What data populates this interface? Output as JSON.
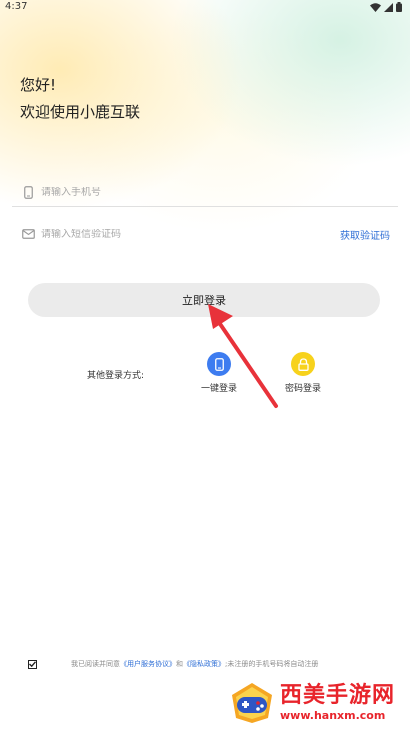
{
  "status_bar": {
    "time": "4:37",
    "icons": [
      "wifi-icon",
      "signal-icon",
      "battery-icon"
    ]
  },
  "header": {
    "greeting": "您好!",
    "welcome": "欢迎使用小鹿互联"
  },
  "form": {
    "phone_placeholder": "请输入手机号",
    "phone_value": "",
    "code_placeholder": "请输入短信验证码",
    "code_value": "",
    "get_code_label": "获取验证码",
    "login_label": "立即登录"
  },
  "alt_login": {
    "label": "其他登录方式:",
    "options": [
      {
        "label": "一键登录",
        "icon": "phone-icon",
        "color": "#3d7cf0"
      },
      {
        "label": "密码登录",
        "icon": "lock-icon",
        "color": "#f7d21c"
      }
    ]
  },
  "agreement": {
    "checked": true,
    "prefix": "我已阅读并同意",
    "terms_link": "《用户服务协议》",
    "and": "和",
    "privacy_link": "《隐私政策》",
    "suffix": ";未注册的手机号码将自动注册"
  },
  "watermark": {
    "title": "西美手游网",
    "url": "www.hanxm.com"
  },
  "colors": {
    "link": "#2f6fd6",
    "button_bg": "#ebebeb",
    "arrow": "#e8323a",
    "watermark": "#e8242b"
  }
}
